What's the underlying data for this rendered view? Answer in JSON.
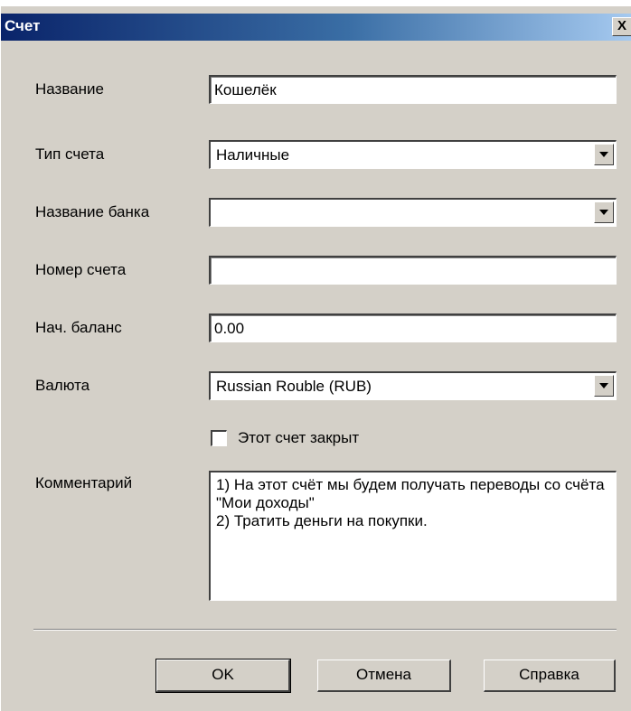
{
  "window": {
    "title": "Счет",
    "close_glyph": "X"
  },
  "form": {
    "name_label": "Название",
    "name_value": "Кошелёк",
    "type_label": "Тип счета",
    "type_value": "Наличные",
    "bank_label": "Название банка",
    "bank_value": "",
    "number_label": "Номер счета",
    "number_value": "",
    "balance_label": "Нач. баланс",
    "balance_value": "0.00",
    "currency_label": "Валюта",
    "currency_value": "Russian Rouble (RUB)",
    "closed_label": "Этот счет закрыт",
    "closed_checked": false,
    "comment_label": "Комментарий",
    "comment_value": "1) На этот счёт мы будем получать переводы со счёта \"Мои доходы\"\n2) Тратить деньги на покупки."
  },
  "buttons": {
    "ok": "OK",
    "cancel": "Отмена",
    "help": "Справка"
  },
  "icons": {
    "dropdown": "chevron-down-icon",
    "close": "close-icon"
  }
}
